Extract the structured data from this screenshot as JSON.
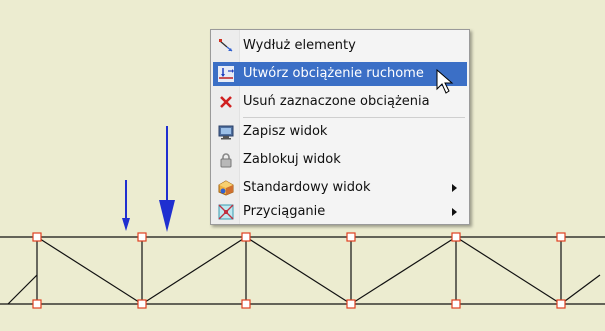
{
  "context_menu": {
    "items": [
      {
        "label": "Wydłuż elementy",
        "icon": "extend-elements-icon"
      },
      {
        "label": "Utwórz obciążenie ruchome",
        "icon": "moving-load-icon"
      },
      {
        "label": "Usuń zaznaczone obciążenia",
        "icon": "delete-x-icon"
      },
      {
        "label": "Zapisz widok",
        "icon": "save-view-icon"
      },
      {
        "label": "Zablokuj widok",
        "icon": "lock-icon"
      },
      {
        "label": "Standardowy widok",
        "icon": "standard-view-icon",
        "submenu": true
      },
      {
        "label": "Przyciąganie",
        "icon": "snap-icon",
        "submenu": true
      }
    ],
    "highlighted_index": 1
  },
  "colors": {
    "canvas_bg": "#ececd0",
    "truss_line": "#111111",
    "node_outline": "#e04020",
    "load_arrow": "#1f2fd0",
    "highlight": "#3b6fc6"
  }
}
